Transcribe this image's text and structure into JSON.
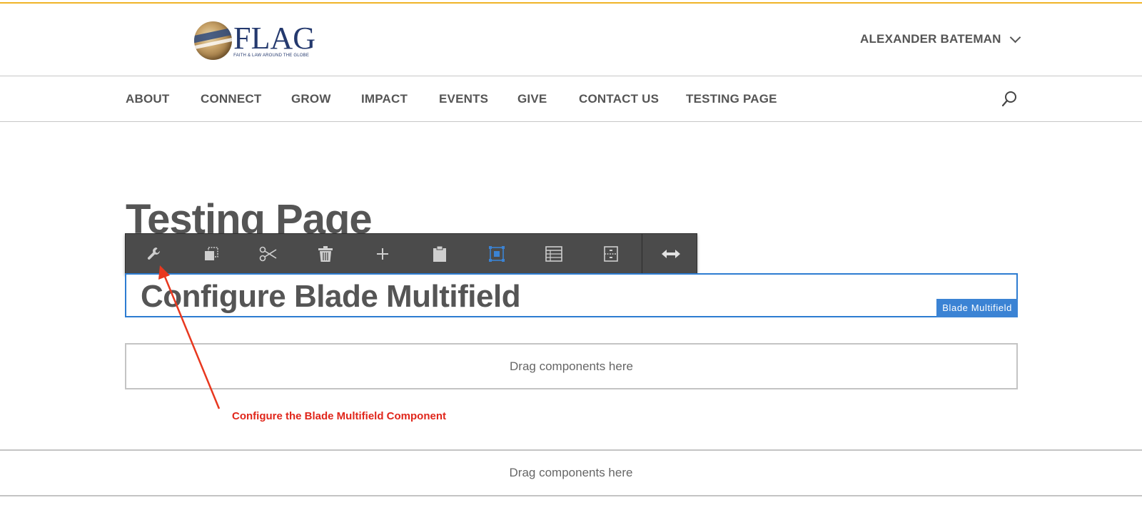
{
  "colors": {
    "accent_rule": "#f0b429",
    "selection": "#2d7cd1",
    "badge": "#3b83d4",
    "toolbar_bg": "#4b4b4b",
    "annotation": "#e0261b",
    "brand_navy": "#24396e"
  },
  "header": {
    "logo": {
      "word": "FLAG",
      "tagline": "FAITH & LAW AROUND THE GLOBE",
      "icon": "globe-logo-icon"
    },
    "user": {
      "name": "ALEXANDER BATEMAN",
      "icon": "chevron-down-icon"
    }
  },
  "nav": {
    "items": [
      {
        "label": "ABOUT"
      },
      {
        "label": "CONNECT"
      },
      {
        "label": "GROW"
      },
      {
        "label": "IMPACT"
      },
      {
        "label": "EVENTS"
      },
      {
        "label": "GIVE"
      },
      {
        "label": "CONTACT US"
      },
      {
        "label": "TESTING PAGE"
      }
    ],
    "search_icon": "search-icon"
  },
  "main": {
    "page_title": "Testing Page",
    "toolbar": {
      "buttons": [
        {
          "name": "configure",
          "icon": "wrench-icon"
        },
        {
          "name": "copy",
          "icon": "copy-icon"
        },
        {
          "name": "cut",
          "icon": "scissors-icon"
        },
        {
          "name": "delete",
          "icon": "trash-icon"
        },
        {
          "name": "insert",
          "icon": "plus-icon"
        },
        {
          "name": "paste",
          "icon": "clipboard-icon"
        },
        {
          "name": "group",
          "icon": "group-select-icon",
          "active": true
        },
        {
          "name": "layout",
          "icon": "table-layout-icon"
        },
        {
          "name": "parent",
          "icon": "parent-select-icon"
        },
        {
          "name": "resize",
          "icon": "resize-arrows-icon"
        }
      ]
    },
    "selected_component": {
      "heading": "Configure Blade Multifield",
      "badge": "Blade Multifield"
    },
    "drop_zone_inner": "Drag components here",
    "drop_zone_outer": "Drag components here"
  },
  "annotation": {
    "text": "Configure the Blade Multifield Component"
  }
}
